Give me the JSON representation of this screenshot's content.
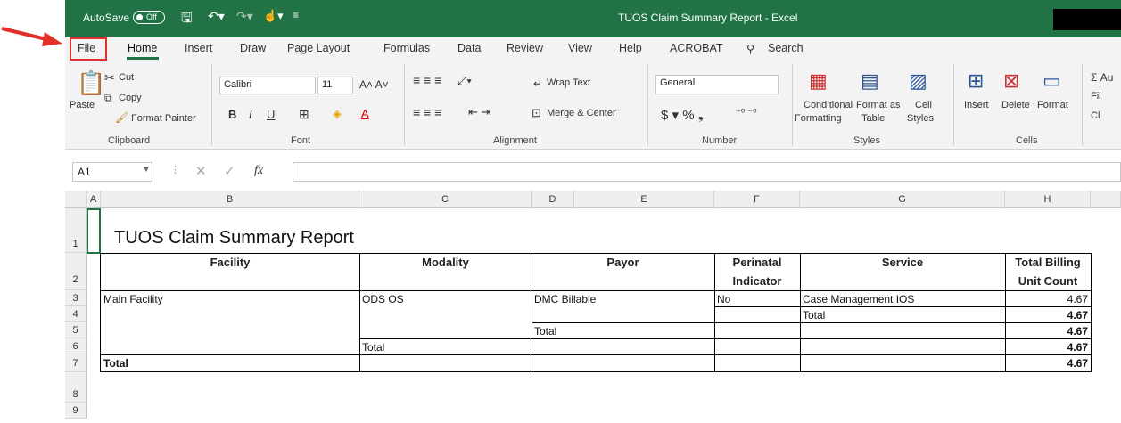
{
  "app": {
    "title": "TUOS Claim Summary Report  -  Excel",
    "autosave_label": "AutoSave",
    "autosave_state": "Off"
  },
  "tabs": [
    "File",
    "Home",
    "Insert",
    "Draw",
    "Page Layout",
    "Formulas",
    "Data",
    "Review",
    "View",
    "Help",
    "ACROBAT"
  ],
  "search_label": "Search",
  "ribbon": {
    "clipboard": {
      "paste": "Paste",
      "cut": "Cut",
      "copy": "Copy",
      "format_painter": "Format Painter",
      "label": "Clipboard"
    },
    "font": {
      "name": "Calibri",
      "size": "11",
      "label": "Font"
    },
    "alignment": {
      "wrap": "Wrap Text",
      "merge": "Merge & Center",
      "label": "Alignment"
    },
    "number": {
      "format": "General",
      "label": "Number"
    },
    "styles": {
      "cond1": "Conditional",
      "cond2": "Formatting",
      "fmt1": "Format as",
      "fmt2": "Table",
      "cell1": "Cell",
      "cell2": "Styles",
      "label": "Styles"
    },
    "cells": {
      "insert": "Insert",
      "delete": "Delete",
      "format": "Format",
      "label": "Cells"
    },
    "editing": {
      "a": "Σ Au",
      "b": "Fil",
      "c": "Cl"
    }
  },
  "formula_bar": {
    "name_box": "A1",
    "fx": "fx",
    "formula": ""
  },
  "columns": [
    "A",
    "B",
    "C",
    "D",
    "E",
    "F",
    "G",
    "H"
  ],
  "rows": [
    "1",
    "2",
    "3",
    "4",
    "5",
    "6",
    "7",
    "8",
    "9"
  ],
  "report": {
    "title": "TUOS Claim Summary Report",
    "headers": {
      "facility": "Facility",
      "modality": "Modality",
      "payor": "Payor",
      "perinatal1": "Perinatal",
      "perinatal2": "Indicator",
      "service": "Service",
      "total1": "Total Billing",
      "total2": "Unit Count"
    },
    "facility": "Main Facility",
    "modality": "ODS OS",
    "payor": "DMC Billable",
    "perinatal": "No",
    "service": "Case Management IOS",
    "total_label": "Total",
    "value": "4.67"
  }
}
